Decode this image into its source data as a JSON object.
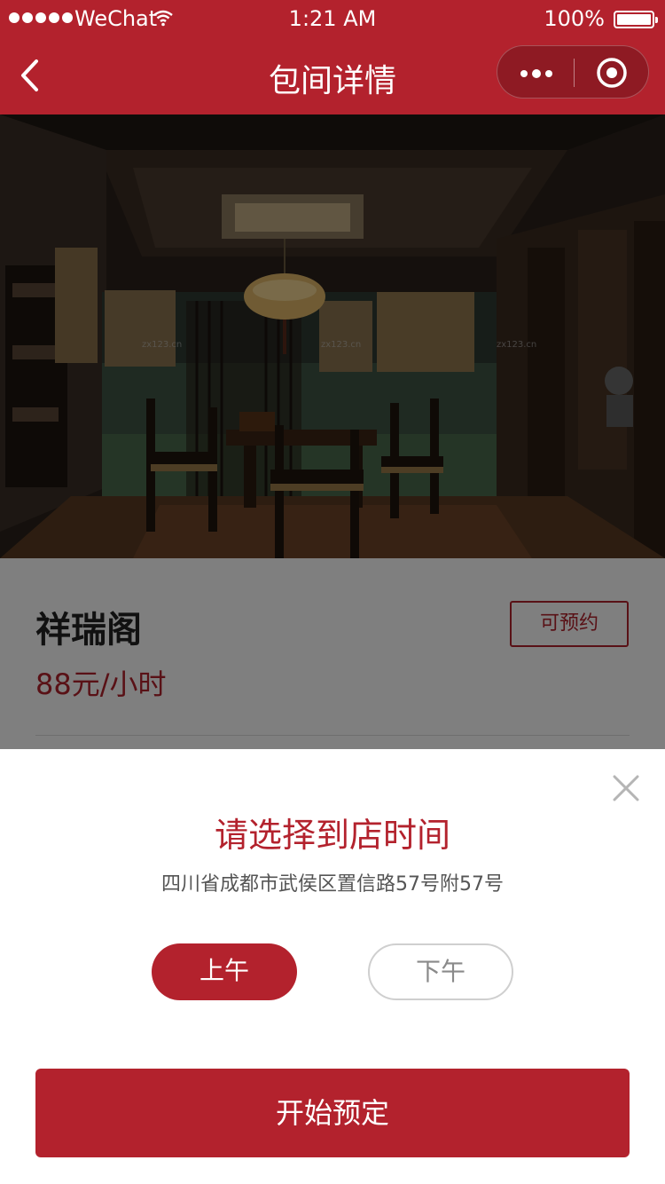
{
  "status_bar": {
    "carrier": "WeChat",
    "time": "1:21 AM",
    "battery": "100%"
  },
  "nav": {
    "title": "包间详情",
    "icons": [
      "chevron-left-icon",
      "more-dots-icon",
      "target-icon"
    ]
  },
  "room": {
    "name": "祥瑞阁",
    "price": "88元/小时",
    "availability": "可预约",
    "photo_watermarks": [
      "zx123.cn",
      "zx123.cn",
      "zx123.cn"
    ]
  },
  "time_sheet": {
    "title": "请选择到店时间",
    "address": "四川省成都市武侯区置信路57号附57号",
    "slots": [
      "上午",
      "下午"
    ],
    "selected_slot": "上午",
    "book_label": "开始预定",
    "close_icon": "close-icon"
  },
  "colors": {
    "brand": "#b3222d",
    "overlay": "rgba(0,0,0,0.5)",
    "text_dark": "#222222",
    "text_muted": "#555555"
  }
}
